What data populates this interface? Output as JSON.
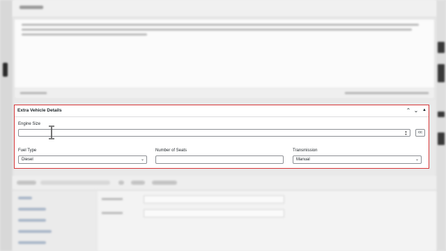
{
  "panel": {
    "title": "Extra Vehicle Details",
    "header_icons": [
      "chevron-up-icon",
      "chevron-down-icon",
      "triangle-up-icon"
    ],
    "engine_size": {
      "label": "Engine Size",
      "value": "",
      "unit": "cc"
    },
    "fuel_type": {
      "label": "Fuel Type",
      "selected": "Diesel"
    },
    "number_of_seats": {
      "label": "Number of Seats",
      "value": ""
    },
    "transmission": {
      "label": "Transmission",
      "selected": "Manual"
    }
  },
  "colors": {
    "panel_border": "#d63638",
    "text": "#1d2327",
    "field_border": "#8c8f94"
  }
}
